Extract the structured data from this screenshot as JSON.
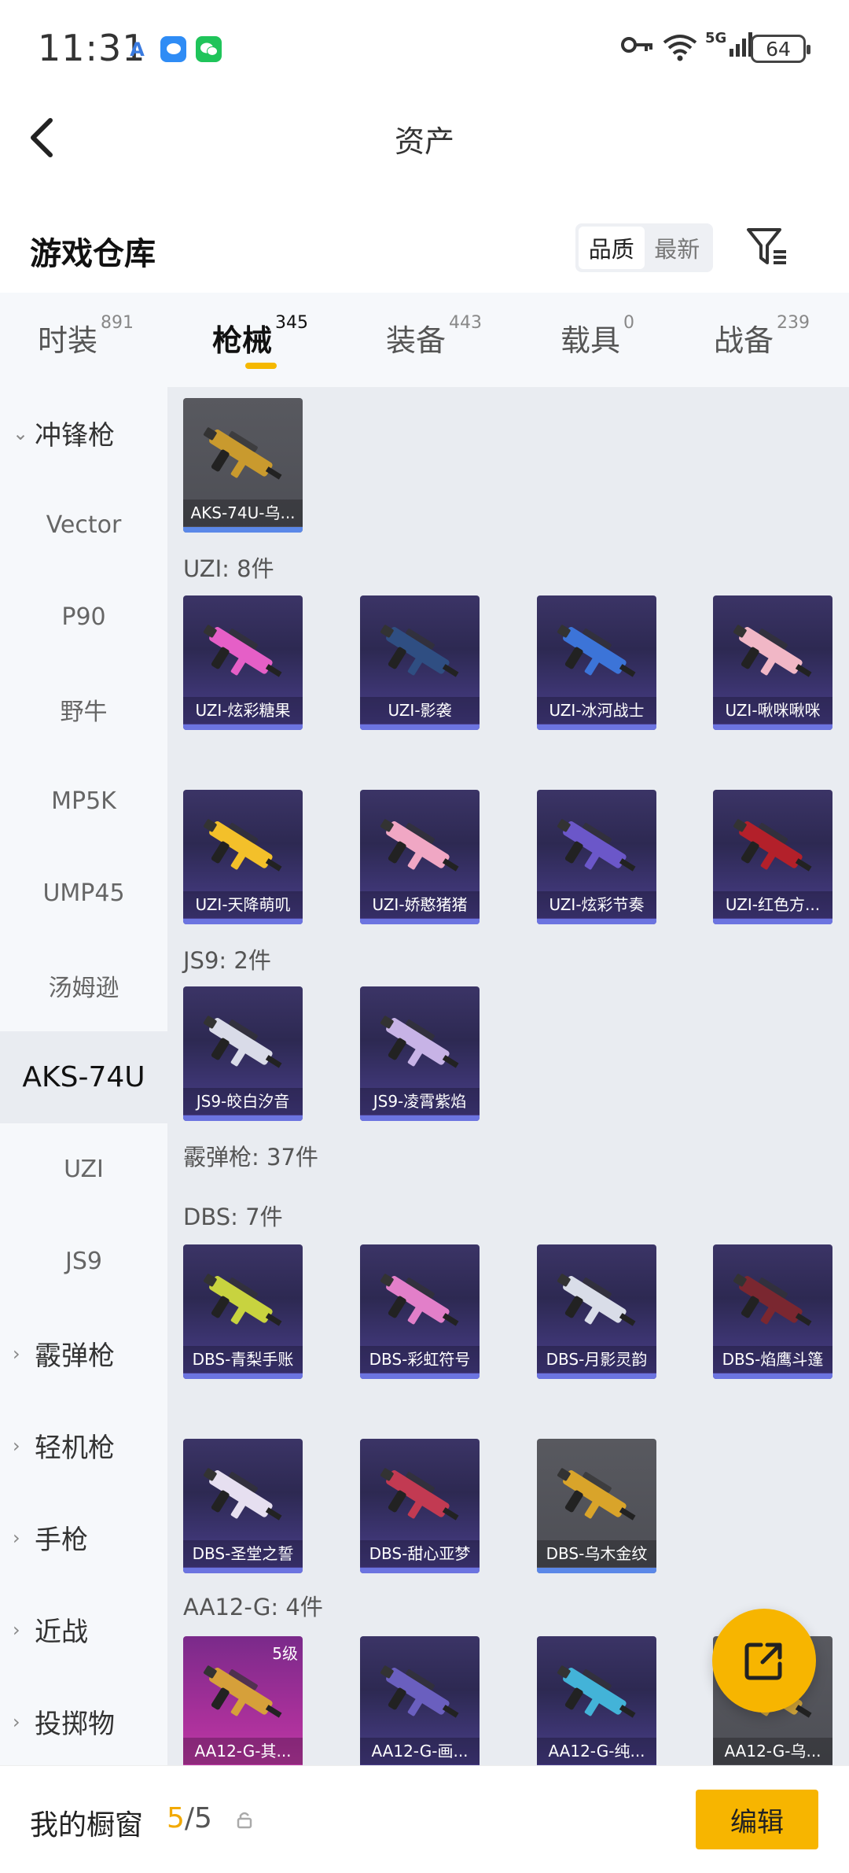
{
  "status": {
    "time": "11:31",
    "network": "5G",
    "battery": "64"
  },
  "nav": {
    "title": "资产"
  },
  "section": {
    "title": "游戏仓库",
    "sort_options": [
      "品质",
      "最新"
    ],
    "sort_selected": "品质"
  },
  "tabs": [
    {
      "label": "时装",
      "count": "891"
    },
    {
      "label": "枪械",
      "count": "345"
    },
    {
      "label": "装备",
      "count": "443"
    },
    {
      "label": "载具",
      "count": "0"
    },
    {
      "label": "战备",
      "count": "239"
    }
  ],
  "sidebar": [
    {
      "label": "冲锋枪",
      "chev": "⌄"
    },
    {
      "label": "Vector"
    },
    {
      "label": "P90"
    },
    {
      "label": "野牛"
    },
    {
      "label": "MP5K"
    },
    {
      "label": "UMP45"
    },
    {
      "label": "汤姆逊"
    },
    {
      "label": "AKS-74U"
    },
    {
      "label": "UZI"
    },
    {
      "label": "JS9"
    },
    {
      "label": "霰弹枪",
      "chev": "›"
    },
    {
      "label": "轻机枪",
      "chev": "›"
    },
    {
      "label": "手枪",
      "chev": "›"
    },
    {
      "label": "近战",
      "chev": "›"
    },
    {
      "label": "投掷物",
      "chev": "›"
    }
  ],
  "groups": {
    "uzi": "UZI: 8件",
    "js9": "JS9: 2件",
    "shotgun": "霰弹枪: 37件",
    "dbs": "DBS: 7件",
    "aa12": "AA12-G: 4件"
  },
  "items": [
    {
      "name": "AKS-74U-乌...",
      "color": "#c99a2e"
    },
    {
      "name": "UZI-炫彩糖果",
      "color": "#e55fc7"
    },
    {
      "name": "UZI-影袭",
      "color": "#2f4e82"
    },
    {
      "name": "UZI-冰河战士",
      "color": "#3c74d8"
    },
    {
      "name": "UZI-啾咪啾咪",
      "color": "#f1b7c6"
    },
    {
      "name": "UZI-天降萌叽",
      "color": "#f3c02a"
    },
    {
      "name": "UZI-娇憨猪猪",
      "color": "#f0a7c4"
    },
    {
      "name": "UZI-炫彩节奏",
      "color": "#6b57c9"
    },
    {
      "name": "UZI-红色方...",
      "color": "#b3202a"
    },
    {
      "name": "JS9-皎白汐音",
      "color": "#d9dbe8"
    },
    {
      "name": "JS9-凌霄紫焰",
      "color": "#c7b3e6"
    },
    {
      "name": "DBS-青梨手账",
      "color": "#c8d33f"
    },
    {
      "name": "DBS-彩虹符号",
      "color": "#e27fc9"
    },
    {
      "name": "DBS-月影灵韵",
      "color": "#d9dde8"
    },
    {
      "name": "DBS-焰鹰斗篷",
      "color": "#7a2730"
    },
    {
      "name": "DBS-圣堂之誓",
      "color": "#e6dff0"
    },
    {
      "name": "DBS-甜心亚梦",
      "color": "#c23a52"
    },
    {
      "name": "DBS-乌木金纹",
      "color": "#d9a42a"
    },
    {
      "name": "AA12-G-其...",
      "color": "#d6a03a",
      "level": "5级"
    },
    {
      "name": "AA12-G-画...",
      "color": "#6a5fbf"
    },
    {
      "name": "AA12-G-纯...",
      "color": "#43b3d8"
    },
    {
      "name": "AA12-G-乌...",
      "color": "#d0a43a"
    }
  ],
  "bottom": {
    "label": "我的橱窗",
    "count_current": "5",
    "count_total": "/5",
    "edit_label": "编辑"
  },
  "colors": {
    "accent": "#f7b500"
  }
}
